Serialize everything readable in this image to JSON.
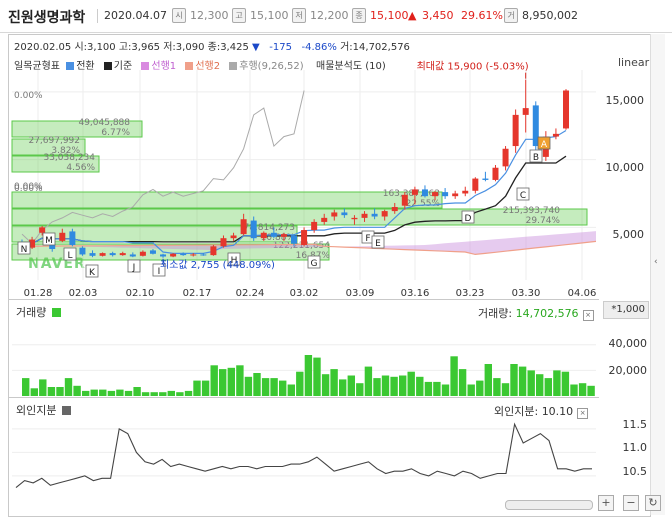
{
  "header": {
    "title": "진원생명과학",
    "date": "2020.04.07",
    "open_icon": "시",
    "open_value": "12,300",
    "high_icon": "고",
    "high_value": "15,100",
    "low_icon": "저",
    "low_value": "12,200",
    "close_icon": "종",
    "close_value": "15,100",
    "change_arrow": "▲",
    "change_value": "3,450",
    "change_pct": "29.61%",
    "volume_icon": "거",
    "volume_value": "8,950,002",
    "up_color": "#e0201b"
  },
  "info_line": {
    "date": "2020.02.05",
    "open": "시:3,100",
    "high": "고:3,965",
    "low": "저:3,090",
    "close": "종:3,425",
    "arrow": "▼",
    "change": "-175",
    "pct": "-4.86%",
    "volume": "거:14,702,576"
  },
  "legend": {
    "title": "일목균형표",
    "items": [
      {
        "label": "전환",
        "color": "#4a90e2"
      },
      {
        "label": "기준",
        "color": "#222222"
      },
      {
        "label": "선행1",
        "color": "#d98ae0"
      },
      {
        "label": "선행2",
        "color": "#f0a08a"
      },
      {
        "label": "후행(9,26,52)",
        "color": "#aaaaaa"
      }
    ],
    "profile": "매물분석도 (10)"
  },
  "scale_label": "linear",
  "annotations": {
    "max_label": "최대값 15,900 (-5.03%)",
    "min_label": "최소값 2,755 (448.09%)",
    "watermark": "NAVER"
  },
  "volume_panel": {
    "title": "거래량",
    "readout_label": "거래량:",
    "readout_value": "14,702,576",
    "unit": "*1,000",
    "close_glyph": "×"
  },
  "foreign_panel": {
    "title": "외인지분",
    "readout_label": "외인지분:",
    "readout_value": "10.10",
    "close_glyph": "×"
  },
  "controls": {
    "zoom_in": "+",
    "zoom_out": "−",
    "refresh": "↻",
    "collapse": "‹"
  },
  "chart_data": [
    {
      "type": "candlestick",
      "scale": "linear",
      "x_ticks": [
        "01.28",
        "02.03",
        "02.10",
        "02.17",
        "02.24",
        "03.02",
        "03.09",
        "03.16",
        "03.23",
        "03.30",
        "04.06"
      ],
      "y_ticks": [
        5000,
        10000,
        15000
      ],
      "y_tick_labels": [
        "5,000",
        "10,000",
        "15,000"
      ],
      "ylim": [
        2000,
        19000
      ],
      "candles": [
        {
          "o": 3800,
          "h": 4100,
          "l": 3300,
          "c": 3400
        },
        {
          "o": 3500,
          "h": 4300,
          "l": 3400,
          "c": 4100
        },
        {
          "o": 4600,
          "h": 5100,
          "l": 4400,
          "c": 5000
        },
        {
          "o": 3800,
          "h": 3900,
          "l": 3200,
          "c": 3400
        },
        {
          "o": 4000,
          "h": 4900,
          "l": 3900,
          "c": 4600
        },
        {
          "o": 4700,
          "h": 4900,
          "l": 3600,
          "c": 3700
        },
        {
          "o": 3500,
          "h": 3600,
          "l": 2900,
          "c": 3000
        },
        {
          "o": 3100,
          "h": 3300,
          "l": 2800,
          "c": 2900
        },
        {
          "o": 2900,
          "h": 3150,
          "l": 2850,
          "c": 3100
        },
        {
          "o": 3100,
          "h": 3200,
          "l": 2850,
          "c": 2950
        },
        {
          "o": 2950,
          "h": 3200,
          "l": 2900,
          "c": 3100
        },
        {
          "o": 3000,
          "h": 3150,
          "l": 2800,
          "c": 2850
        },
        {
          "o": 2900,
          "h": 3300,
          "l": 2850,
          "c": 3200
        },
        {
          "o": 3300,
          "h": 3400,
          "l": 3000,
          "c": 3050
        },
        {
          "o": 3000,
          "h": 3050,
          "l": 2755,
          "c": 2850
        },
        {
          "o": 2850,
          "h": 3100,
          "l": 2800,
          "c": 3050
        },
        {
          "o": 3050,
          "h": 3150,
          "l": 2900,
          "c": 2950
        },
        {
          "o": 2950,
          "h": 3100,
          "l": 2850,
          "c": 3000
        },
        {
          "o": 3000,
          "h": 3100,
          "l": 2900,
          "c": 2950
        },
        {
          "o": 2950,
          "h": 3700,
          "l": 2900,
          "c": 3600
        },
        {
          "o": 3600,
          "h": 4400,
          "l": 3500,
          "c": 4200
        },
        {
          "o": 4200,
          "h": 4600,
          "l": 4000,
          "c": 4400
        },
        {
          "o": 4500,
          "h": 6000,
          "l": 4400,
          "c": 5600
        },
        {
          "o": 5500,
          "h": 5800,
          "l": 4000,
          "c": 4200
        },
        {
          "o": 4200,
          "h": 4700,
          "l": 4000,
          "c": 4600
        },
        {
          "o": 4600,
          "h": 5000,
          "l": 4200,
          "c": 4300
        },
        {
          "o": 4300,
          "h": 4600,
          "l": 4000,
          "c": 4500
        },
        {
          "o": 4400,
          "h": 4500,
          "l": 3600,
          "c": 3800
        },
        {
          "o": 3700,
          "h": 5000,
          "l": 3600,
          "c": 4800
        },
        {
          "o": 4800,
          "h": 5600,
          "l": 4600,
          "c": 5400
        },
        {
          "o": 5400,
          "h": 6000,
          "l": 5200,
          "c": 5700
        },
        {
          "o": 5800,
          "h": 6300,
          "l": 5500,
          "c": 6100
        },
        {
          "o": 6100,
          "h": 6400,
          "l": 5700,
          "c": 5900
        },
        {
          "o": 5600,
          "h": 5900,
          "l": 5200,
          "c": 5700
        },
        {
          "o": 5700,
          "h": 6200,
          "l": 5400,
          "c": 6000
        },
        {
          "o": 6000,
          "h": 6400,
          "l": 5600,
          "c": 5800
        },
        {
          "o": 5800,
          "h": 6300,
          "l": 5500,
          "c": 6200
        },
        {
          "o": 6200,
          "h": 6800,
          "l": 6000,
          "c": 6500
        },
        {
          "o": 6600,
          "h": 7600,
          "l": 6300,
          "c": 7400
        },
        {
          "o": 7400,
          "h": 8000,
          "l": 6700,
          "c": 7800
        },
        {
          "o": 7800,
          "h": 8100,
          "l": 7200,
          "c": 7300
        },
        {
          "o": 7300,
          "h": 7700,
          "l": 7000,
          "c": 7600
        },
        {
          "o": 7600,
          "h": 7900,
          "l": 7100,
          "c": 7300
        },
        {
          "o": 7300,
          "h": 7700,
          "l": 7100,
          "c": 7500
        },
        {
          "o": 7500,
          "h": 8000,
          "l": 7300,
          "c": 7700
        },
        {
          "o": 7700,
          "h": 8700,
          "l": 7500,
          "c": 8600
        },
        {
          "o": 8600,
          "h": 9100,
          "l": 8400,
          "c": 8500
        },
        {
          "o": 8500,
          "h": 9600,
          "l": 8400,
          "c": 9400
        },
        {
          "o": 9500,
          "h": 11000,
          "l": 9200,
          "c": 10800
        },
        {
          "o": 11000,
          "h": 13700,
          "l": 10500,
          "c": 13300
        },
        {
          "o": 13300,
          "h": 15900,
          "l": 12000,
          "c": 13800
        },
        {
          "o": 14000,
          "h": 14300,
          "l": 10300,
          "c": 11000
        },
        {
          "o": 10200,
          "h": 12100,
          "l": 9900,
          "c": 11700
        },
        {
          "o": 11700,
          "h": 12300,
          "l": 11500,
          "c": 11900
        },
        {
          "o": 12300,
          "h": 15200,
          "l": 12200,
          "c": 15100
        }
      ],
      "markers": [
        "N",
        "M",
        "L",
        "K",
        "J",
        "I",
        "H",
        "G",
        "F",
        "E",
        "D",
        "C",
        "B",
        "A"
      ],
      "volume_profile": [
        {
          "label": "49,045,888",
          "pct": "6.77%"
        },
        {
          "label": "27,697,992",
          "pct": "3.82%"
        },
        {
          "label": "33,038,234",
          "pct": "4.56%"
        },
        {
          "label": "",
          "pct": "0.00%"
        },
        {
          "label": "",
          "pct": "0.00%"
        },
        {
          "label": "",
          "pct": "0.00%"
        },
        {
          "label": "163,387,163",
          "pct": "22.55%"
        },
        {
          "label": "215,393,740",
          "pct": "29.74%"
        },
        {
          "label": "78,814,273",
          "pct": "10.88%"
        },
        {
          "label": "122,211,654",
          "pct": "16.87%"
        }
      ]
    },
    {
      "type": "bar",
      "title": "거래량",
      "y_ticks": [
        20000,
        40000
      ],
      "y_tick_labels": [
        "20,000",
        "40,000"
      ],
      "ylim": [
        0,
        52000
      ],
      "values": [
        14000,
        6000,
        13000,
        7000,
        7000,
        14000,
        8000,
        4000,
        5000,
        5000,
        4000,
        5000,
        4000,
        7000,
        3000,
        3000,
        3000,
        4000,
        3000,
        4000,
        12000,
        12000,
        24000,
        21000,
        22000,
        24000,
        15000,
        18000,
        14000,
        14000,
        12000,
        9000,
        19000,
        32000,
        30000,
        17000,
        21000,
        13000,
        16000,
        10000,
        23000,
        14000,
        16000,
        15000,
        16000,
        19000,
        15000,
        11000,
        11000,
        9000,
        31000,
        21000,
        9000,
        12000,
        25000,
        14000,
        10000,
        25000,
        23000,
        20000,
        17000,
        14000,
        20000,
        19000,
        9000,
        10000,
        8000
      ]
    },
    {
      "type": "line",
      "title": "외인지분",
      "y_ticks": [
        10.5,
        11.0,
        11.5
      ],
      "y_tick_labels": [
        "10.5",
        "11.0",
        "11.5"
      ],
      "ylim": [
        10.2,
        11.75
      ],
      "values": [
        10.25,
        10.4,
        10.35,
        10.45,
        10.3,
        10.35,
        10.4,
        10.45,
        10.5,
        10.4,
        10.45,
        10.45,
        11.5,
        11.4,
        11.0,
        10.8,
        10.75,
        10.85,
        10.7,
        10.75,
        10.7,
        10.65,
        10.6,
        10.65,
        10.7,
        10.65,
        10.7,
        10.7,
        10.65,
        10.7,
        10.7,
        10.7,
        10.75,
        10.75,
        10.8,
        10.9,
        10.75,
        10.6,
        10.65,
        10.7,
        10.75,
        10.8,
        10.65,
        10.55,
        10.6,
        10.6,
        10.65,
        10.55,
        10.5,
        10.6,
        10.55,
        10.5,
        10.6,
        10.55,
        10.45,
        10.5,
        10.55,
        10.55,
        11.6,
        11.2,
        11.3,
        11.4,
        11.25,
        10.65,
        10.65,
        10.6,
        10.65,
        10.65
      ]
    }
  ]
}
